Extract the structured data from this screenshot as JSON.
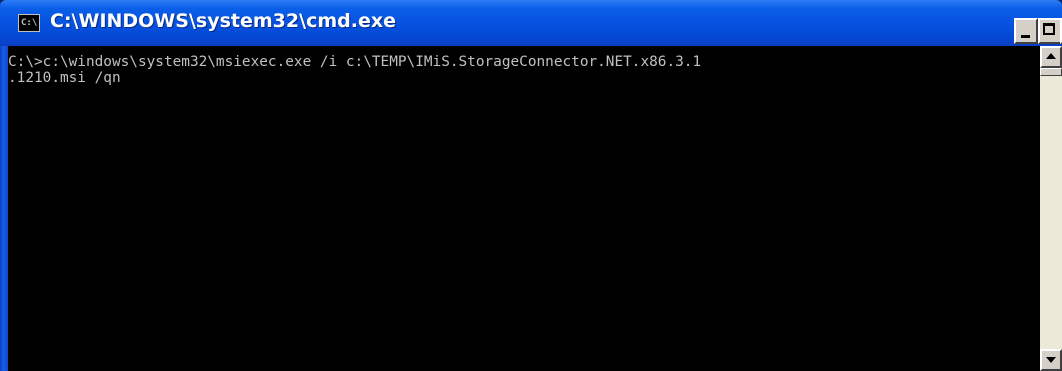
{
  "window": {
    "title": "C:\\WINDOWS\\system32\\cmd.exe",
    "icon_label": "C:\\",
    "icon": "console-icon"
  },
  "title_buttons": {
    "minimize_icon": "minimize-icon",
    "maximize_icon": "maximize-icon",
    "close_icon": "close-icon",
    "close_glyph": "×"
  },
  "console": {
    "lines": [
      "C:\\>c:\\windows\\system32\\msiexec.exe /i c:\\TEMP\\IMiS.StorageConnector.NET.x86.3.1",
      ".1210.msi /qn"
    ],
    "colors": {
      "background": "#000000",
      "foreground": "#c0c0c0"
    }
  },
  "scrollbar": {
    "up_icon": "arrow-up-icon",
    "down_icon": "arrow-down-icon"
  },
  "theme": {
    "titlebar_blue": "#0752e0",
    "frame_blue": "#0a3fc0",
    "button_face": "#d4d0c8"
  }
}
